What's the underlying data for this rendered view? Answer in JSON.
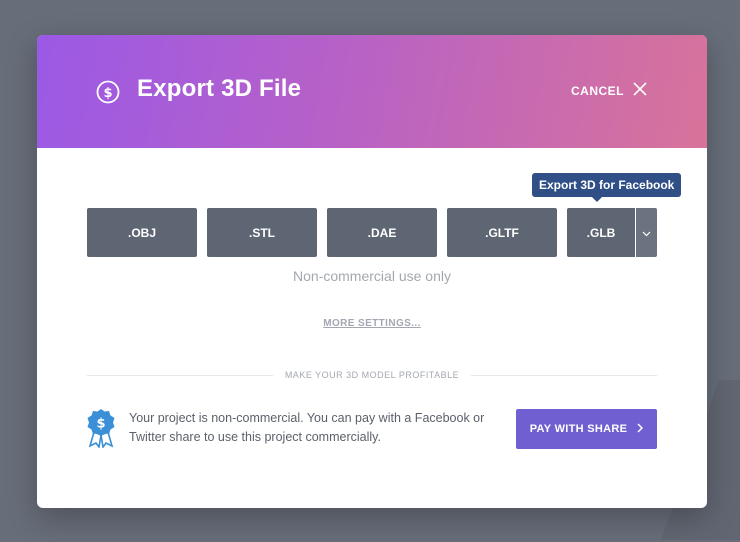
{
  "header": {
    "title": "Export 3D File",
    "cancel_label": "CANCEL"
  },
  "tooltip": {
    "text": "Export 3D for Facebook"
  },
  "formats": [
    {
      "label": ".OBJ"
    },
    {
      "label": ".STL"
    },
    {
      "label": ".DAE"
    },
    {
      "label": ".GLTF"
    },
    {
      "label": ".GLB",
      "has_dropdown": true
    }
  ],
  "note": "Non-commercial use only",
  "more_settings_label": "MORE SETTINGS...",
  "divider_label": "MAKE YOUR 3D MODEL PROFITABLE",
  "promo": {
    "text": "Your project is non-commercial. You can pay with a Facebook or Twitter share to use this project commercially.",
    "button_label": "PAY WITH SHARE"
  },
  "icons": {
    "header": "dollar-coin-icon",
    "cancel": "close-icon",
    "dropdown": "chevron-down-icon",
    "promo": "dollar-badge-icon",
    "pay": "chevron-right-icon"
  },
  "colors": {
    "header_gradient_start": "#9b59e6",
    "header_gradient_end": "#d8739a",
    "format_button": "#5f6673",
    "tooltip": "#2f4f86",
    "pay_button": "#6f5fd1",
    "badge": "#3a8fd6"
  }
}
